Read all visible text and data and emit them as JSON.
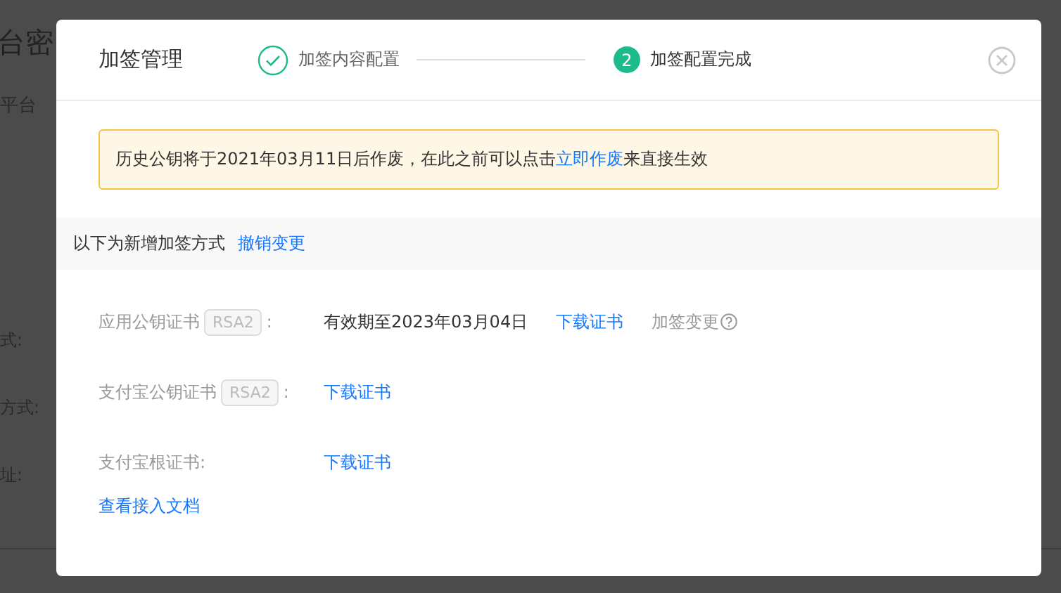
{
  "background_page": {
    "title": "台密",
    "subtitle": "平台",
    "labels": [
      "式:",
      "方式:",
      "址:"
    ]
  },
  "dialog": {
    "title": "加签管理",
    "steps": [
      {
        "label": "加签内容配置",
        "done": true
      },
      {
        "number": "2",
        "label": "加签配置完成",
        "done": false
      }
    ],
    "alert": {
      "text": "历史公钥将于2021年03月11日后作废，在此之前可以点击",
      "link": "立即作废",
      "suffix": "来直接生效"
    },
    "section_bar": {
      "text": "以下为新增加签方式",
      "link": "撤销变更"
    },
    "rows": [
      {
        "label": "应用公钥证书",
        "tag": "RSA2",
        "colon": ":",
        "value": "有效期至2023年03月04日",
        "link": "下载证书",
        "extra": "加签变更"
      },
      {
        "label": "支付宝公钥证书",
        "tag": "RSA2",
        "colon": ":",
        "link": "下载证书"
      },
      {
        "label": "支付宝根证书:",
        "link": "下载证书"
      }
    ],
    "doc_link": "查看接入文档"
  }
}
